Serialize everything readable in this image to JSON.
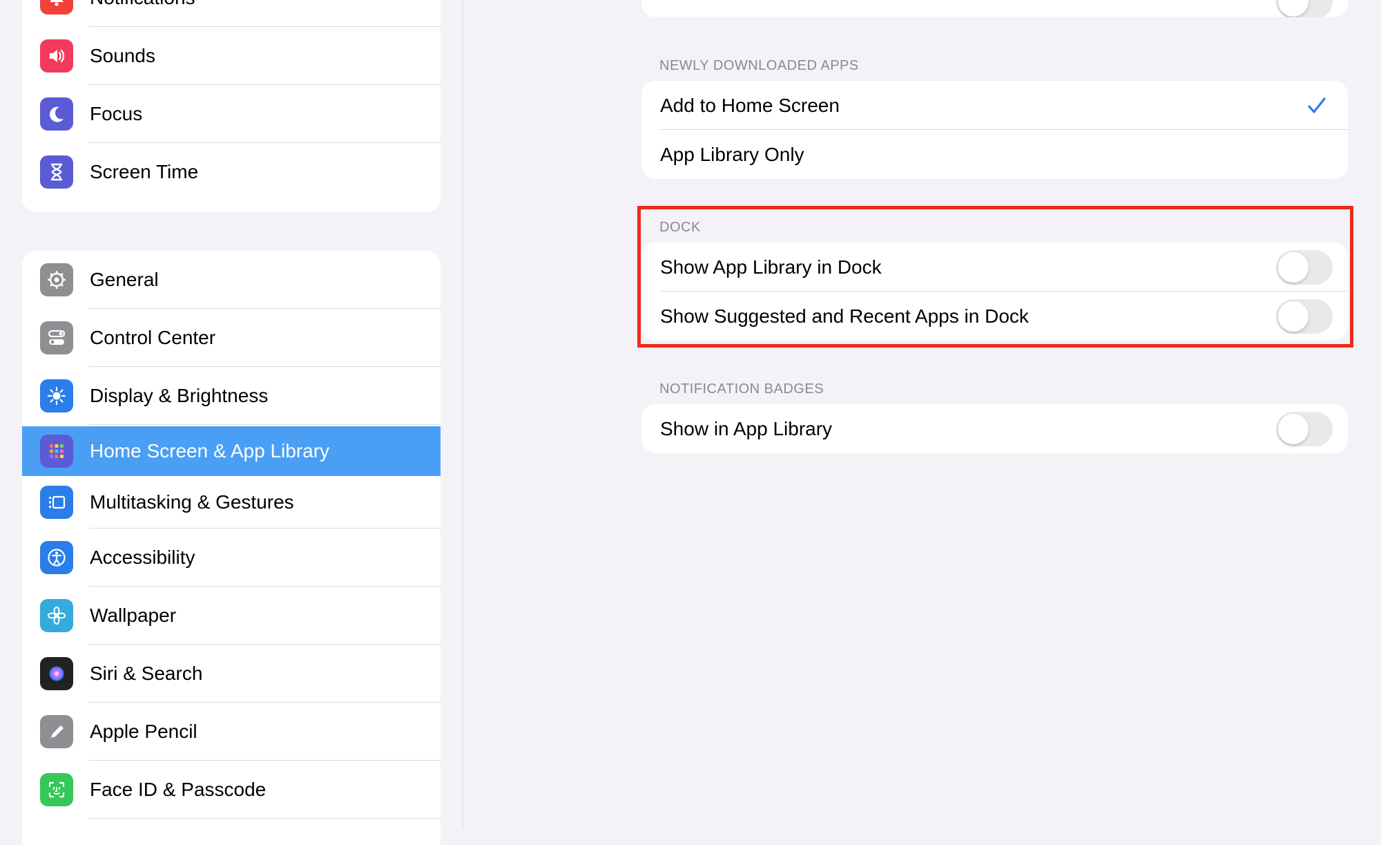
{
  "sidebar": {
    "group1": [
      {
        "label": "Notifications",
        "icon": "bell-icon",
        "color": "#f0413a"
      },
      {
        "label": "Sounds",
        "icon": "speaker-icon",
        "color": "#f23b5c"
      },
      {
        "label": "Focus",
        "icon": "moon-icon",
        "color": "#5b5bd6"
      },
      {
        "label": "Screen Time",
        "icon": "hourglass-icon",
        "color": "#5b5bd6"
      }
    ],
    "group2": [
      {
        "label": "General",
        "icon": "gear-icon",
        "color": "#8e8e93"
      },
      {
        "label": "Control Center",
        "icon": "switches-icon",
        "color": "#8e8e93"
      },
      {
        "label": "Display & Brightness",
        "icon": "sun-icon",
        "color": "#2b7de9"
      },
      {
        "label": "Home Screen & App Library",
        "icon": "app-grid-icon",
        "color": "#5b5bd6",
        "selected": true
      },
      {
        "label": "Multitasking & Gestures",
        "icon": "multitasking-icon",
        "color": "#2b7de9"
      },
      {
        "label": "Accessibility",
        "icon": "accessibility-icon",
        "color": "#2b7de9"
      },
      {
        "label": "Wallpaper",
        "icon": "flower-icon",
        "color": "#35aadc"
      },
      {
        "label": "Siri & Search",
        "icon": "siri-icon",
        "color": "#222222"
      },
      {
        "label": "Apple Pencil",
        "icon": "pencil-icon",
        "color": "#8e8e93"
      },
      {
        "label": "Face ID & Passcode",
        "icon": "face-id-icon",
        "color": "#34c759"
      }
    ]
  },
  "main": {
    "newly_downloaded": {
      "title": "NEWLY DOWNLOADED APPS",
      "options": [
        {
          "label": "Add to Home Screen",
          "checked": true
        },
        {
          "label": "App Library Only",
          "checked": false
        }
      ]
    },
    "dock": {
      "title": "DOCK",
      "items": [
        {
          "label": "Show App Library in Dock",
          "on": false
        },
        {
          "label": "Show Suggested and Recent Apps in Dock",
          "on": false
        }
      ]
    },
    "badges": {
      "title": "NOTIFICATION BADGES",
      "items": [
        {
          "label": "Show in App Library",
          "on": false
        }
      ]
    }
  },
  "colors": {
    "accent": "#4a9ff5",
    "checkmark": "#2b7de9",
    "highlight": "#ee2a1b"
  }
}
